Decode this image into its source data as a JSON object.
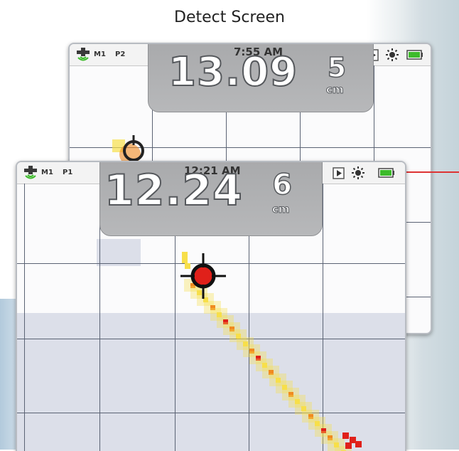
{
  "page_title": "Detect Screen",
  "back_screen": {
    "mode": "M1",
    "profile": "P2",
    "time": "7:55 AM",
    "depth_value": "13.09",
    "depth_number": "5",
    "depth_unit": "cm"
  },
  "front_screen": {
    "mode": "M1",
    "profile": "P1",
    "time": "12:21 AM",
    "depth_value": "12.24",
    "depth_number": "6",
    "depth_unit": "cm"
  },
  "colors": {
    "target_red": "#e0201a",
    "signal_orange": "#f08a20",
    "signal_yellow": "#f7df4a",
    "battery_green": "#3dbb2b",
    "callout_red": "#d33333"
  },
  "icons": [
    "gps-icon",
    "play-icon",
    "sun-icon",
    "battery-icon",
    "crosshair-icon"
  ]
}
